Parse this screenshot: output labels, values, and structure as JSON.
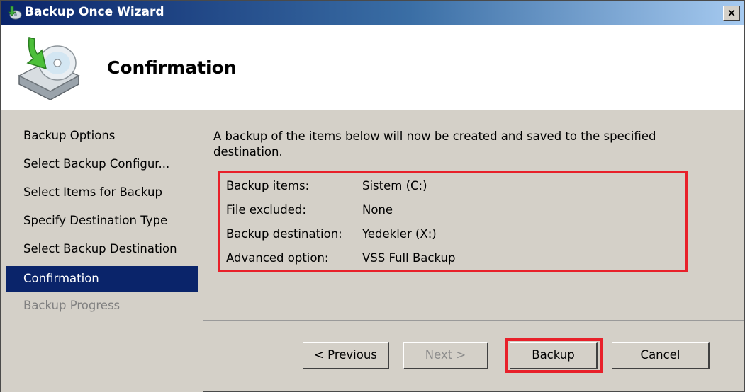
{
  "window": {
    "title": "Backup Once Wizard",
    "close_label": "×"
  },
  "header": {
    "title": "Confirmation"
  },
  "nav": {
    "items": [
      {
        "label": "Backup Options",
        "state": "normal"
      },
      {
        "label": "Select Backup Configur...",
        "state": "normal"
      },
      {
        "label": "Select Items for Backup",
        "state": "normal"
      },
      {
        "label": "Specify Destination Type",
        "state": "normal"
      },
      {
        "label": "Select Backup Destination",
        "state": "normal"
      },
      {
        "label": "Confirmation",
        "state": "active"
      },
      {
        "label": "Backup Progress",
        "state": "disabled"
      }
    ]
  },
  "content": {
    "description": "A backup of the items below will now be created and saved to the specified destination.",
    "summary": [
      {
        "label": "Backup items:",
        "value": "Sistem (C:)"
      },
      {
        "label": "File excluded:",
        "value": "None"
      },
      {
        "label": "Backup destination:",
        "value": "Yedekler (X:)"
      },
      {
        "label": "Advanced option:",
        "value": "VSS Full Backup"
      }
    ]
  },
  "buttons": {
    "previous": "< Previous",
    "next": "Next >",
    "backup": "Backup",
    "cancel": "Cancel"
  },
  "colors": {
    "highlight": "#e8202a",
    "active_nav": "#0a246a"
  }
}
